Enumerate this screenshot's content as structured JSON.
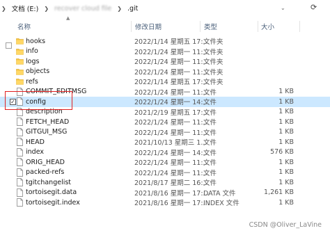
{
  "breadcrumb": {
    "drive": "文档 (E:)",
    "folder": "recover cloud file",
    "current": ".git"
  },
  "columns": {
    "name": "名称",
    "date": "修改日期",
    "type": "类型",
    "size": "大小"
  },
  "rows": [
    {
      "name": "hooks",
      "date": "2022/1/14 星期五 17:...",
      "type": "文件夹",
      "size": "",
      "icon": "folder-icon",
      "selected": false,
      "checked": false
    },
    {
      "name": "info",
      "date": "2022/1/24 星期一 11:...",
      "type": "文件夹",
      "size": "",
      "icon": "folder-icon",
      "selected": false,
      "checked": false
    },
    {
      "name": "logs",
      "date": "2022/1/24 星期一 11:...",
      "type": "文件夹",
      "size": "",
      "icon": "folder-icon",
      "selected": false,
      "checked": false
    },
    {
      "name": "objects",
      "date": "2022/1/24 星期一 11:...",
      "type": "文件夹",
      "size": "",
      "icon": "folder-icon",
      "selected": false,
      "checked": false
    },
    {
      "name": "refs",
      "date": "2022/1/14 星期五 17:...",
      "type": "文件夹",
      "size": "",
      "icon": "folder-icon",
      "selected": false,
      "checked": false
    },
    {
      "name": "COMMIT_EDITMSG",
      "date": "2022/1/24 星期一 11:...",
      "type": "文件",
      "size": "1 KB",
      "icon": "file-icon",
      "selected": false,
      "checked": false
    },
    {
      "name": "config",
      "date": "2022/1/24 星期一 14:...",
      "type": "文件",
      "size": "1 KB",
      "icon": "file-icon",
      "selected": true,
      "checked": true
    },
    {
      "name": "description",
      "date": "2021/2/19 星期五 17:...",
      "type": "文件",
      "size": "1 KB",
      "icon": "file-icon",
      "selected": false,
      "checked": false
    },
    {
      "name": "FETCH_HEAD",
      "date": "2022/1/24 星期一 11:...",
      "type": "文件",
      "size": "1 KB",
      "icon": "file-icon",
      "selected": false,
      "checked": false
    },
    {
      "name": "GITGUI_MSG",
      "date": "2022/1/24 星期一 11:...",
      "type": "文件",
      "size": "1 KB",
      "icon": "file-icon",
      "selected": false,
      "checked": false
    },
    {
      "name": "HEAD",
      "date": "2021/10/13 星期三 1...",
      "type": "文件",
      "size": "1 KB",
      "icon": "file-icon",
      "selected": false,
      "checked": false
    },
    {
      "name": "index",
      "date": "2022/1/24 星期一 14:...",
      "type": "文件",
      "size": "576 KB",
      "icon": "file-icon",
      "selected": false,
      "checked": false
    },
    {
      "name": "ORIG_HEAD",
      "date": "2022/1/24 星期一 11:...",
      "type": "文件",
      "size": "1 KB",
      "icon": "file-icon",
      "selected": false,
      "checked": false
    },
    {
      "name": "packed-refs",
      "date": "2022/1/24 星期一 11:...",
      "type": "文件",
      "size": "1 KB",
      "icon": "file-icon",
      "selected": false,
      "checked": false
    },
    {
      "name": "tgitchangelist",
      "date": "2021/8/17 星期二 16:...",
      "type": "文件",
      "size": "1 KB",
      "icon": "file-icon",
      "selected": false,
      "checked": false
    },
    {
      "name": "tortoisegit.data",
      "date": "2021/8/16 星期一 17:...",
      "type": "DATA 文件",
      "size": "1,261 KB",
      "icon": "file-icon",
      "selected": false,
      "checked": false
    },
    {
      "name": "tortoisegit.index",
      "date": "2021/8/16 星期一 17:...",
      "type": "INDEX 文件",
      "size": "1 KB",
      "icon": "file-icon",
      "selected": false,
      "checked": false
    }
  ],
  "watermark": "CSDN @Oliver_LaVine",
  "colors": {
    "selection": "#cce8ff",
    "highlight_border": "#e02020",
    "folder": "#f5c342"
  }
}
